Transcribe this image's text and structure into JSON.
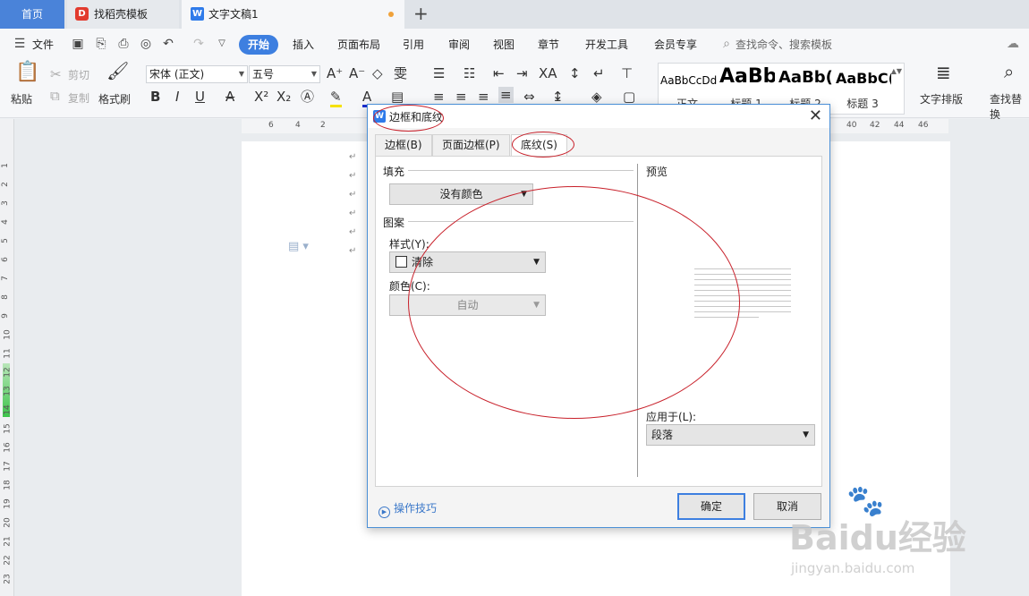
{
  "tabs": [
    {
      "label": "首页"
    },
    {
      "label": "找稻壳模板"
    },
    {
      "label": "文字文稿1"
    }
  ],
  "menubar": {
    "file": "文件",
    "items": [
      "开始",
      "插入",
      "页面布局",
      "引用",
      "审阅",
      "视图",
      "章节",
      "开发工具",
      "会员专享"
    ],
    "search": "查找命令、搜索模板"
  },
  "ribbon": {
    "paste": "粘贴",
    "cut": "剪切",
    "copy": "复制",
    "format_painter": "格式刷",
    "font_name": "宋体 (正文)",
    "font_size": "五号",
    "styles": [
      {
        "sample": "AaBbCcDd",
        "label": "正文"
      },
      {
        "sample": "AaBb",
        "label": "标题 1"
      },
      {
        "sample": "AaBb(",
        "label": "标题 2"
      },
      {
        "sample": "AaBbC(",
        "label": "标题 3"
      }
    ],
    "text_layout": "文字排版",
    "find_replace": "查找替换"
  },
  "ruler": {
    "h_numbers": [
      "6",
      "4",
      "2",
      "40",
      "42",
      "44",
      "46"
    ],
    "v_numbers": [
      "1",
      "2",
      "3",
      "4",
      "5",
      "6",
      "7",
      "8",
      "9",
      "10",
      "11",
      "12",
      "13",
      "14",
      "15",
      "16",
      "17",
      "18",
      "19",
      "20",
      "21",
      "22",
      "23"
    ]
  },
  "dialog": {
    "title": "边框和底纹",
    "tabs": [
      "边框(B)",
      "页面边框(P)",
      "底纹(S)"
    ],
    "fill_label": "填充",
    "fill_value": "没有颜色",
    "pattern_label": "图案",
    "style_label": "样式(Y):",
    "style_value": "清除",
    "color_label": "颜色(C):",
    "color_value": "自动",
    "preview_label": "预览",
    "apply_label": "应用于(L):",
    "apply_value": "段落",
    "tips": "操作技巧",
    "ok": "确定",
    "cancel": "取消"
  },
  "watermark": {
    "brand": "Baidu经验",
    "url": "jingyan.baidu.com"
  },
  "colors": {
    "accent": "#3d7fe0",
    "annotation": "#c8202a"
  }
}
